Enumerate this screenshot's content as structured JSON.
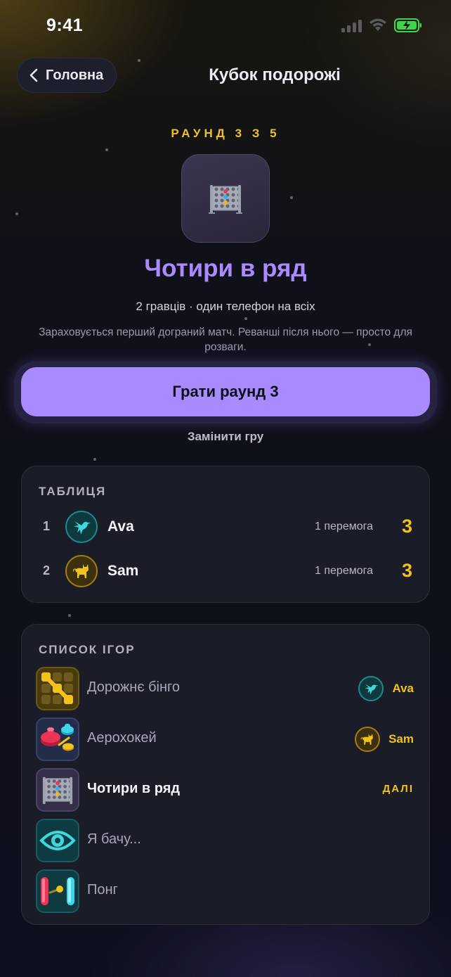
{
  "status_bar": {
    "time": "9:41"
  },
  "header": {
    "back_label": "Головна",
    "title": "Кубок подорожі"
  },
  "hero": {
    "round_label": "РАУНД 3 З 5",
    "game_name": "Чотири в ряд",
    "meta": "2 гравців · один телефон на всіх",
    "note": "Зараховується перший дограний матч. Реванші після нього — просто для розваги."
  },
  "actions": {
    "play_label": "Грати раунд 3",
    "swap_label": "Замінити гру"
  },
  "leaderboard": {
    "title": "ТАБЛИЦЯ",
    "rows": [
      {
        "rank": "1",
        "name": "Ava",
        "wins": "1 перемога",
        "score": "3",
        "avatar_icon": "hummingbird-icon"
      },
      {
        "rank": "2",
        "name": "Sam",
        "wins": "1 перемога",
        "score": "3",
        "avatar_icon": "cat-icon"
      }
    ]
  },
  "game_list": {
    "title": "СПИСОК ІГОР",
    "items": [
      {
        "name": "Дорожнє бінго",
        "winner": "Ava",
        "icon": "bingo-grid-icon"
      },
      {
        "name": "Аерохокей",
        "winner": "Sam",
        "icon": "air-hockey-icon"
      },
      {
        "name": "Чотири в ряд",
        "tag": "ДАЛІ",
        "icon": "connect-four-icon"
      },
      {
        "name": "Я бачу...",
        "icon": "eye-icon"
      },
      {
        "name": "Понг",
        "icon": "pong-icon"
      }
    ]
  },
  "colors": {
    "accent": "#a98bff",
    "gold": "#f0c21d",
    "teal": "#1e8a8e"
  }
}
